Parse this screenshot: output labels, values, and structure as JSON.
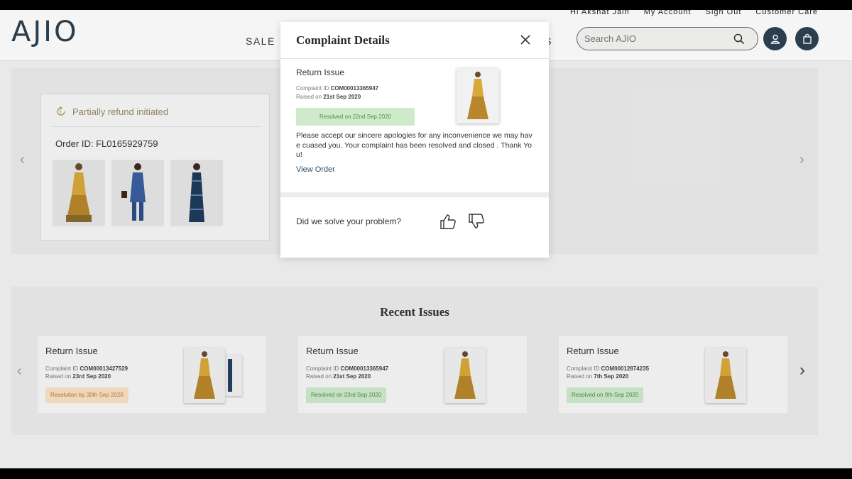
{
  "header": {
    "logo": "AJIO",
    "top_links": [
      "Hi Akshat Jain",
      "My Account",
      "Sign Out",
      "Customer Care"
    ],
    "nav": {
      "sale": "SALE",
      "partial_right": "LS"
    },
    "search_placeholder": "Search AJIO"
  },
  "order": {
    "status": "Partially refund initiated",
    "order_id": "Order ID: FL0165929759"
  },
  "modal": {
    "title": "Complaint Details",
    "issue_title": "Return Issue",
    "complaint_label": "Complaint ID",
    "complaint_id": "COM00013365947",
    "raised_label": "Raised on",
    "raised_date": "21st Sep 2020",
    "status": "Resolved on 22nd Sep 2020",
    "message": "Please accept our sincere apologies for any inconvenience we may have cuased you. Your complaint has been resolved and closed . Thank You!",
    "view_order": "View Order",
    "feedback_question": "Did we solve your problem?"
  },
  "recent": {
    "title": "Recent Issues",
    "issues": [
      {
        "title": "Return Issue",
        "complaint_id": "COM00013427529",
        "raised": "23rd Sep 2020",
        "status": "Resolution by 30th Sep 2020",
        "status_type": "pending"
      },
      {
        "title": "Return Issue",
        "complaint_id": "COM00013365947",
        "raised": "21st Sep 2020",
        "status": "Resolved on 23rd Sep 2020",
        "status_type": "resolved"
      },
      {
        "title": "Return Issue",
        "complaint_id": "COM00012874235",
        "raised": "7th Sep 2020",
        "status": "Resolved on 9th Sep 2020",
        "status_type": "resolved"
      }
    ],
    "complaint_label": "Complaint ID",
    "raised_label": "Raised on"
  },
  "colors": {
    "brand": "#2c4152",
    "resolved_bg": "#cfeacb",
    "resolved_text": "#4f8f4a",
    "pending_bg": "#fbe1c4",
    "pending_text": "#b17a38"
  },
  "icons": {
    "search": "search-icon",
    "user": "user-icon",
    "bag": "shopping-bag-icon",
    "close": "close-icon",
    "refund": "refund-icon",
    "thumbs_up": "thumbs-up-icon",
    "thumbs_down": "thumbs-down-icon"
  }
}
